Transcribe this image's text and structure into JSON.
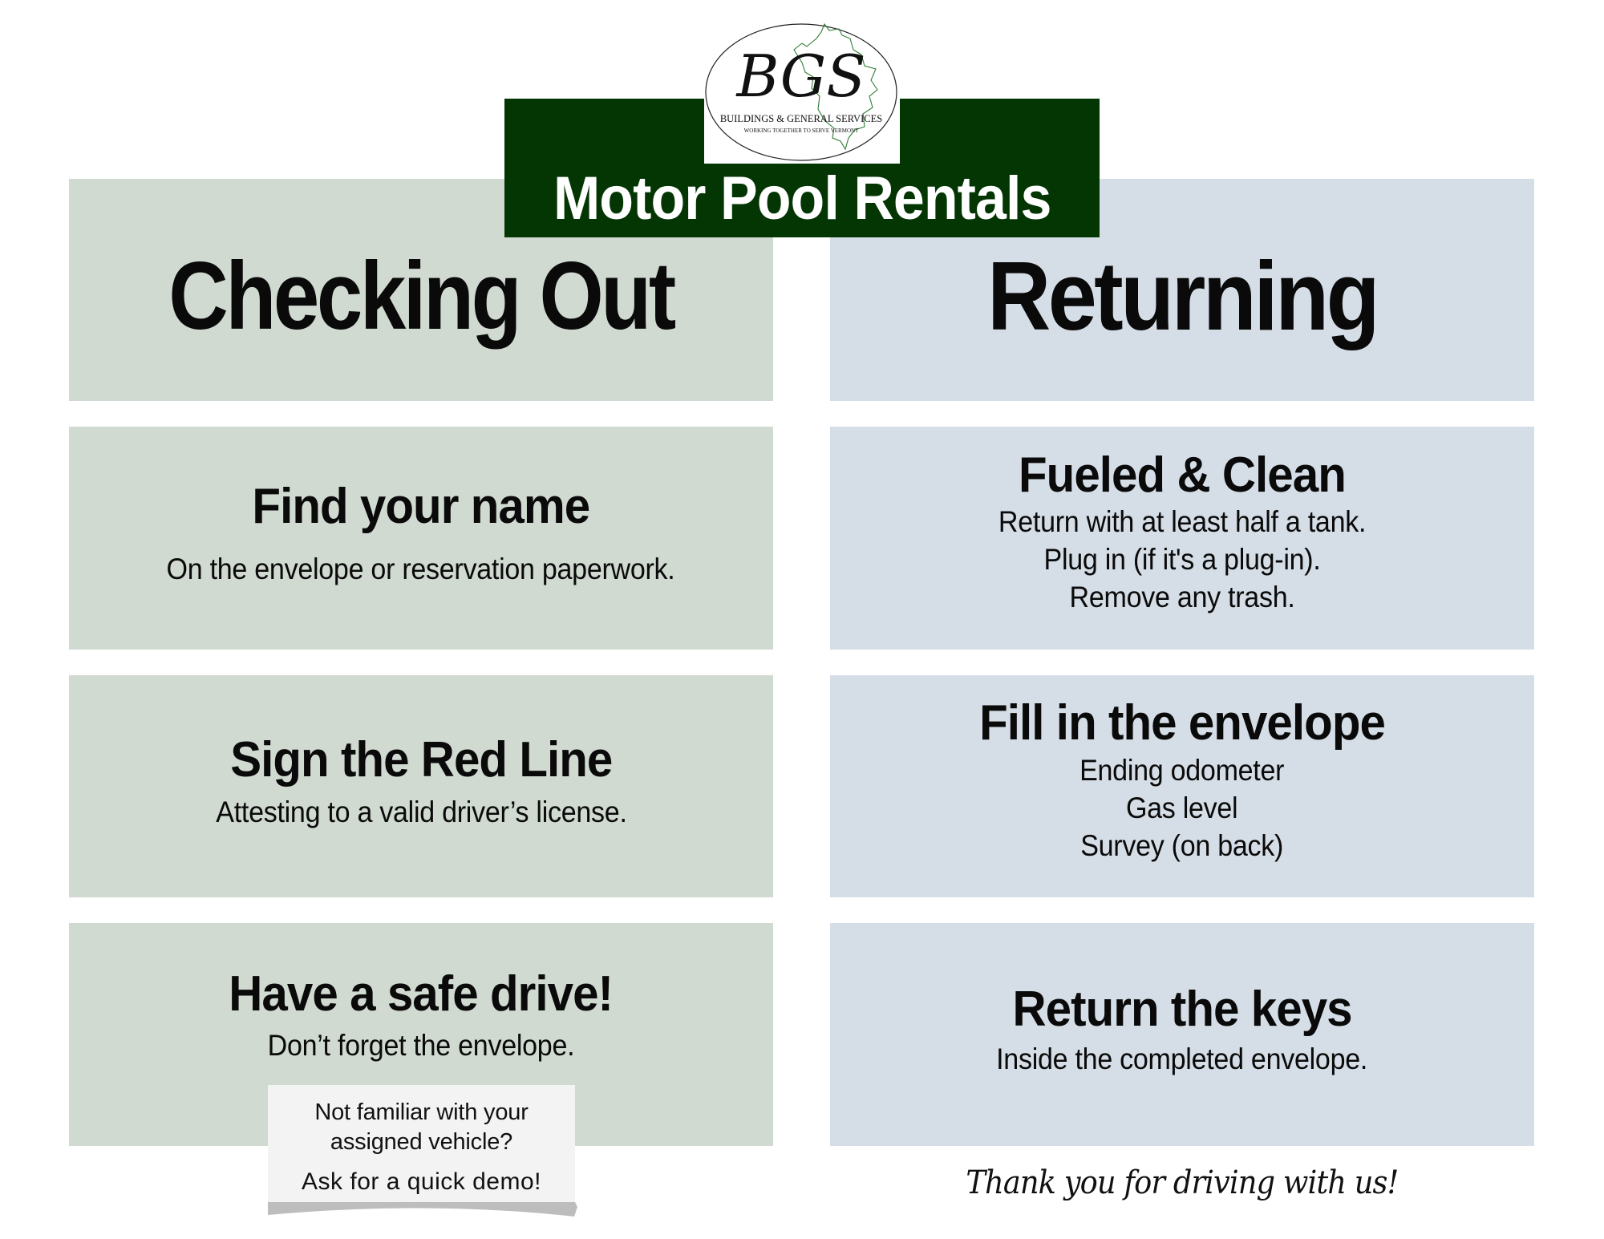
{
  "header": {
    "title": "Motor Pool Rentals",
    "logo": {
      "monogram": "BGS",
      "name": "BUILDINGS & GENERAL SERVICES",
      "tagline": "WORKING TOGETHER TO SERVE VERMONT",
      "icon": "vermont-state-outline-icon"
    }
  },
  "colors": {
    "banner": "#033603",
    "checkout_panel": "#D0DAD1",
    "returning_panel": "#D5DDE6",
    "note_bg": "#F3F3F3",
    "text": "#0A0A0A"
  },
  "checking_out": {
    "heading": "Checking Out",
    "steps": [
      {
        "title": "Find your name",
        "lines": [
          "On the envelope or reservation paperwork."
        ]
      },
      {
        "title": "Sign the Red Line",
        "lines": [
          "Attesting to a valid driver’s license."
        ]
      },
      {
        "title": "Have a safe drive!",
        "lines": [
          "Don’t forget the envelope."
        ]
      }
    ],
    "note": {
      "question_line1": "Not familiar with your",
      "question_line2": "assigned vehicle?",
      "answer": "Ask for a quick demo!"
    }
  },
  "returning": {
    "heading": "Returning",
    "steps": [
      {
        "title": "Fueled & Clean",
        "lines": [
          "Return with at least half a tank.",
          "Plug in (if it's a plug-in).",
          "Remove any trash."
        ]
      },
      {
        "title": "Fill in the envelope",
        "lines": [
          "Ending odometer",
          "Gas level",
          "Survey (on back)"
        ]
      },
      {
        "title": "Return the keys",
        "lines": [
          "Inside the completed envelope."
        ]
      }
    ],
    "footer": "Thank you for driving with us!"
  }
}
